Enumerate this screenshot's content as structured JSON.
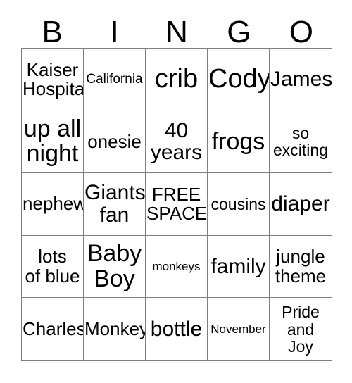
{
  "card": {
    "title": "BINGO",
    "header_letters": [
      "B",
      "I",
      "N",
      "G",
      "O"
    ],
    "colors": {
      "background": "#ffffff",
      "text": "#000000",
      "grid_line": "#808080"
    },
    "rows": [
      [
        {
          "text": "Kaiser\nHospital",
          "size": "md",
          "free": false
        },
        {
          "text": "California",
          "size": "xs",
          "free": false
        },
        {
          "text": "crib",
          "size": "xxl",
          "free": false
        },
        {
          "text": "Cody",
          "size": "xxl",
          "free": false
        },
        {
          "text": "James",
          "size": "lg",
          "free": false
        }
      ],
      [
        {
          "text": "up all\nnight",
          "size": "xl",
          "free": false
        },
        {
          "text": "onesie",
          "size": "md",
          "free": false
        },
        {
          "text": "40\nyears",
          "size": "lg",
          "free": false
        },
        {
          "text": "frogs",
          "size": "xl",
          "free": false
        },
        {
          "text": "so\nexciting",
          "size": "sm",
          "free": false
        }
      ],
      [
        {
          "text": "nephew",
          "size": "md",
          "free": false
        },
        {
          "text": "Giants\nfan",
          "size": "lg",
          "free": false
        },
        {
          "text": "FREE\nSPACE",
          "size": "md",
          "free": true
        },
        {
          "text": "cousins",
          "size": "sm",
          "free": false
        },
        {
          "text": "diaper",
          "size": "lg",
          "free": false
        }
      ],
      [
        {
          "text": "lots\nof blue",
          "size": "md",
          "free": false
        },
        {
          "text": "Baby\nBoy",
          "size": "xl",
          "free": false
        },
        {
          "text": "monkeys",
          "size": "xxs",
          "free": false
        },
        {
          "text": "family",
          "size": "lg",
          "free": false
        },
        {
          "text": "jungle\ntheme",
          "size": "md",
          "free": false
        }
      ],
      [
        {
          "text": "Charles",
          "size": "md",
          "free": false
        },
        {
          "text": "Monkey",
          "size": "md",
          "free": false
        },
        {
          "text": "bottle",
          "size": "lg",
          "free": false
        },
        {
          "text": "November",
          "size": "xxs",
          "free": false
        },
        {
          "text": "Pride\nand\nJoy",
          "size": "sm",
          "free": false
        }
      ]
    ]
  }
}
